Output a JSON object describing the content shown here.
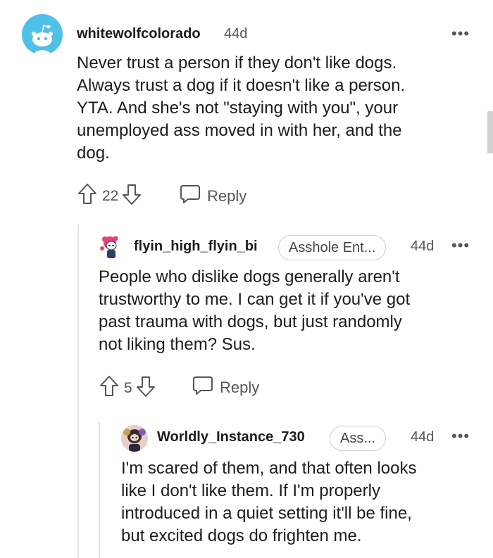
{
  "comments": [
    {
      "username": "whitewolfcolorado",
      "age": "44d",
      "text": [
        "Never trust a person if they don't like dogs.",
        "Always trust a dog if it doesn't like a person.",
        "YTA. And she's not \"staying with you\", your",
        "unemployed ass moved in with her, and the",
        "dog."
      ],
      "votes": "22",
      "reply_label": "Reply"
    },
    {
      "username": "flyin_high_flyin_bi",
      "flair": "Asshole Ent...",
      "age": "44d",
      "text": [
        "People who dislike dogs generally aren't",
        "trustworthy to me. I can get it if you've got",
        "past trauma with dogs, but just randomly",
        "not liking them? Sus."
      ],
      "votes": "5",
      "reply_label": "Reply"
    },
    {
      "username": "Worldly_Instance_730",
      "flair": "Ass...",
      "age": "44d",
      "text": [
        "I'm scared of them, and that often looks",
        "like I don't like them. If I'm properly",
        "introduced in a quiet setting it'll be fine,",
        "but excited dogs do frighten me."
      ]
    }
  ],
  "more_label": "•••"
}
